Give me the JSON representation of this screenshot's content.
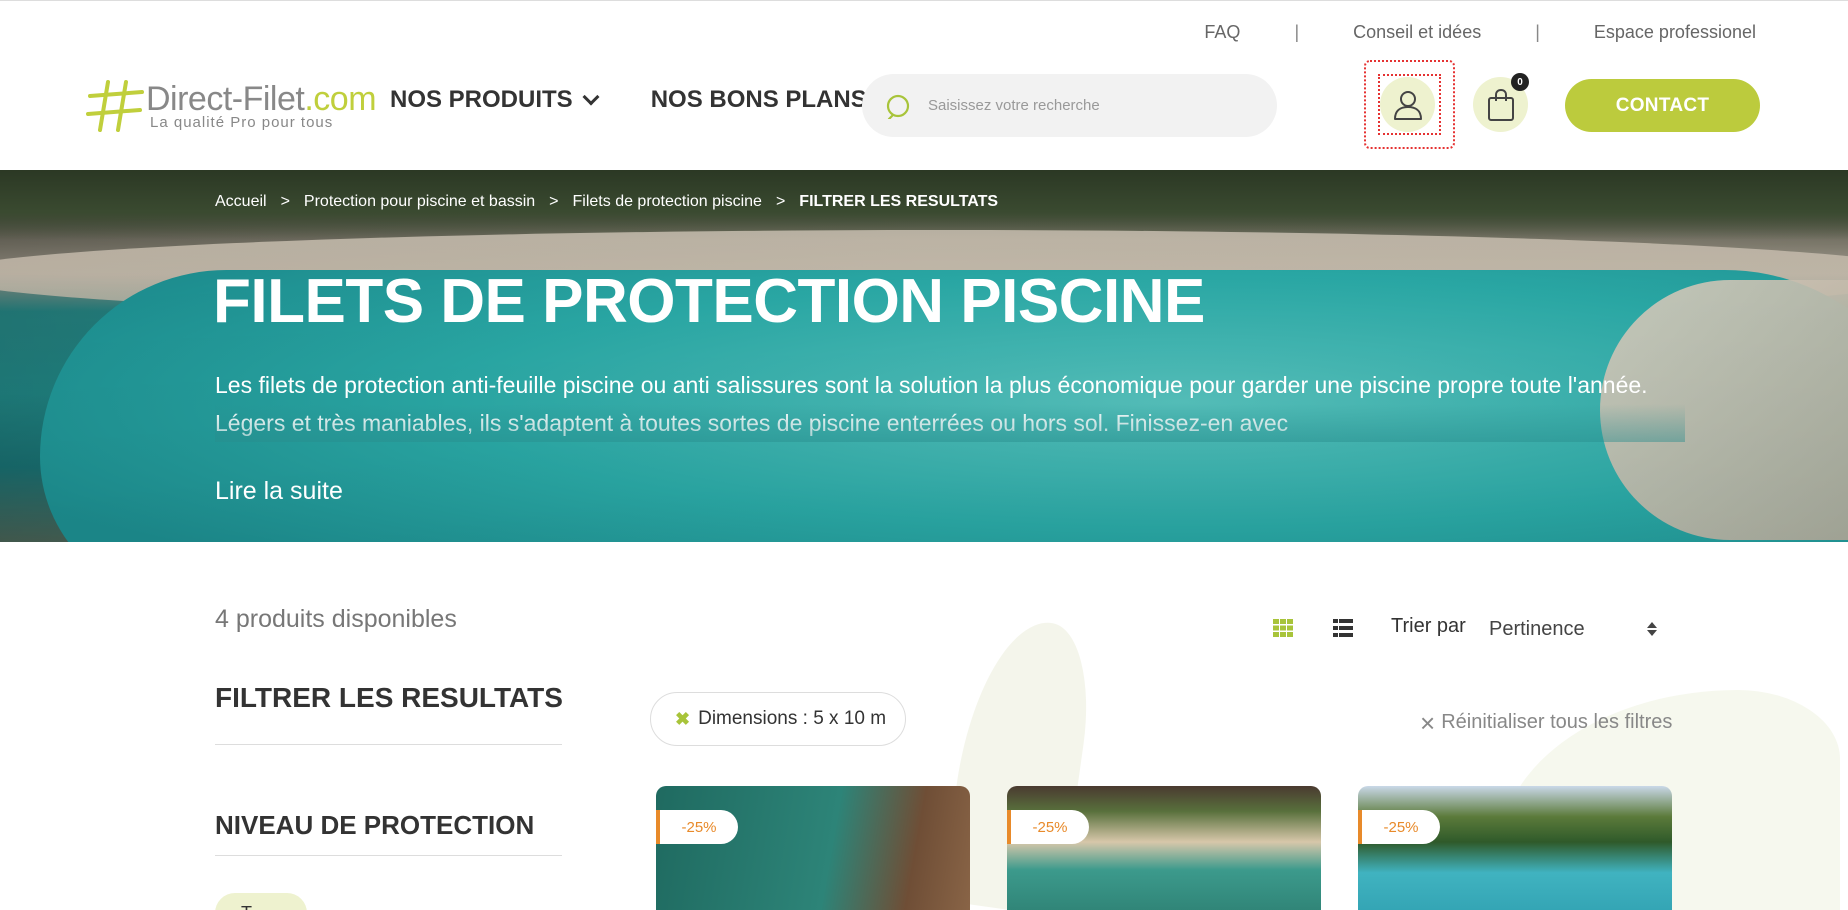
{
  "toplinks": {
    "faq": "FAQ",
    "separator": "|",
    "conseil": "Conseil et idées",
    "espace": "Espace professionel"
  },
  "header": {
    "logo_name": "Direct-Filet",
    "logo_domain": ".com",
    "logo_tagline": "La qualité Pro pour tous",
    "nav": {
      "produits": "NOS PRODUITS",
      "bons_plans": "NOS BONS PLANS"
    },
    "search_placeholder": "Saisissez votre recherche",
    "cart_count": "0",
    "contact_label": "CONTACT"
  },
  "hero": {
    "breadcrumb": {
      "home": "Accueil",
      "level1": "Protection pour piscine et bassin",
      "level2": "Filets de protection piscine",
      "current": "FILTRER LES RESULTATS",
      "sep": ">"
    },
    "title": "FILETS DE PROTECTION PISCINE",
    "description": "Les filets de protection anti-feuille piscine ou anti salissures sont la solution la plus économique pour garder une piscine propre toute l'année. Légers et très maniables, ils s'adaptent à toutes sortes de piscine enterrées ou hors sol. Finissez-en avec",
    "read_more": "Lire la suite"
  },
  "listing": {
    "count_text": "4 produits disponibles",
    "sort_label": "Trier par",
    "sort_value": "Pertinence",
    "filter_title": "FILTRER LES RESULTATS",
    "filter_section": "NIVEAU DE PROTECTION",
    "filter_chip_partial": "T",
    "active_filter": "Dimensions : 5 x 10 m",
    "reset_label": "Réinitialiser tous les filtres",
    "products": [
      {
        "discount": "-25%"
      },
      {
        "discount": "-25%"
      },
      {
        "discount": "-25%"
      }
    ]
  },
  "colors": {
    "accent": "#bccb3d",
    "accent_light": "#eef2cf",
    "discount": "#e88a2a"
  }
}
